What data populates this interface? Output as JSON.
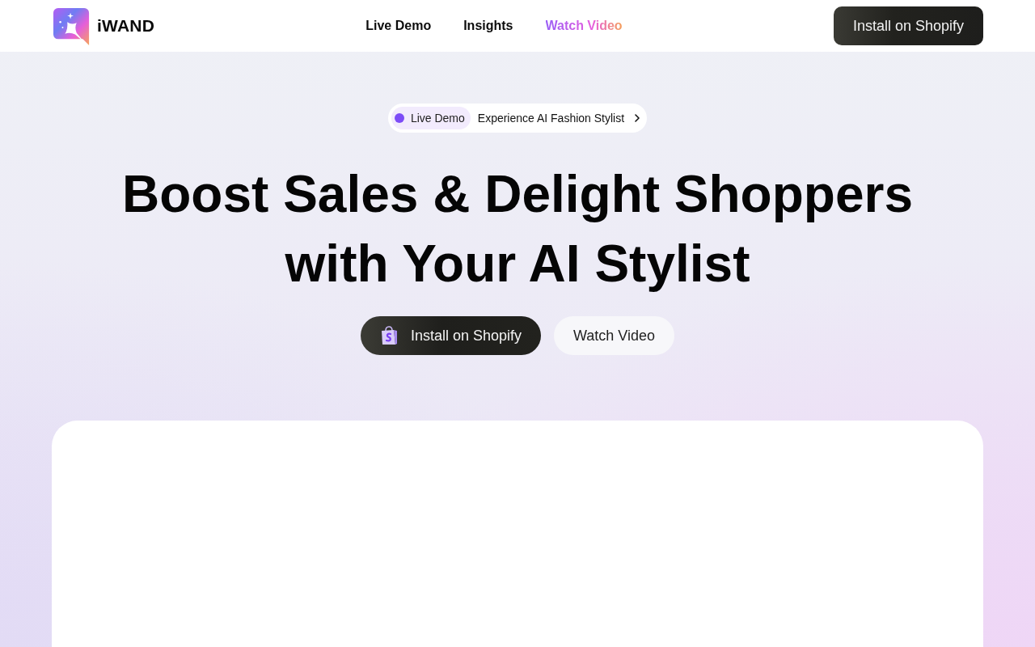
{
  "header": {
    "logo": {
      "wordmark": "iWAND"
    },
    "nav": [
      {
        "label": "Live Demo",
        "highlighted": false
      },
      {
        "label": "Insights",
        "highlighted": false
      },
      {
        "label": "Watch Video",
        "highlighted": true
      }
    ],
    "install_button": "Install on Shopify"
  },
  "hero": {
    "badge": {
      "tag": "Live Demo",
      "text": "Experience AI Fashion Stylist"
    },
    "title": "Boost Sales & Delight Shoppers with Your AI Stylist",
    "buttons": [
      {
        "kind": "primary",
        "label": "Install on Shopify"
      },
      {
        "kind": "secondary",
        "label": "Watch Video"
      }
    ]
  }
}
